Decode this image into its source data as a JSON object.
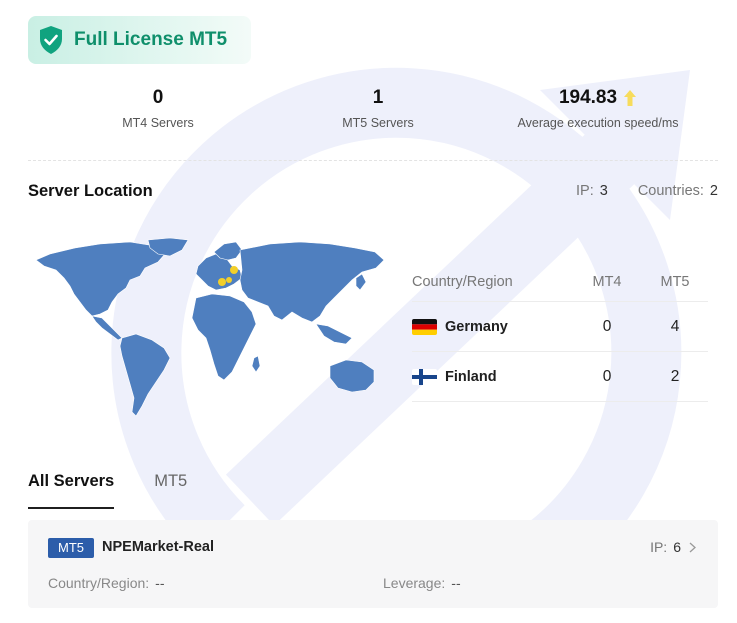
{
  "license": {
    "label": "Full License MT5",
    "icon": "shield-check-icon",
    "color": "#0f8f6b"
  },
  "stats": [
    {
      "value": "0",
      "caption": "MT4 Servers"
    },
    {
      "value": "1",
      "caption": "MT5 Servers"
    },
    {
      "value": "194.83",
      "caption": "Average execution speed/ms",
      "icon": "up-arrow-icon"
    }
  ],
  "location": {
    "title": "Server Location",
    "ip_label": "IP:",
    "ip_value": "3",
    "countries_label": "Countries:",
    "countries_value": "2"
  },
  "country_table": {
    "headers": [
      "Country/Region",
      "MT4",
      "MT5"
    ],
    "rows": [
      {
        "country": "Germany",
        "mt4": "0",
        "mt5": "4",
        "flag": "germany-flag"
      },
      {
        "country": "Finland",
        "mt4": "0",
        "mt5": "2",
        "flag": "finland-flag"
      }
    ]
  },
  "tabs": [
    {
      "label": "All Servers",
      "active": true
    },
    {
      "label": "MT5",
      "active": false
    }
  ],
  "server": {
    "tag": "MT5",
    "name": "NPEMarket-Real",
    "ip_label": "IP:",
    "ip_value": "6",
    "country_label": "Country/Region:",
    "country_value": "--",
    "leverage_label": "Leverage:",
    "leverage_value": "--"
  },
  "colors": {
    "accent": "#2c5daa",
    "map": "#4f7fbf",
    "marker": "#f2cf2a",
    "badge_text": "#0f8f6b"
  }
}
